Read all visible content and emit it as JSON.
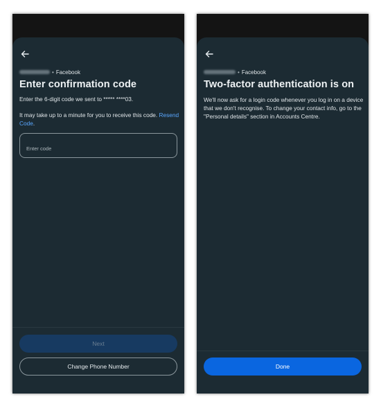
{
  "left_screen": {
    "account": {
      "name": "",
      "separator": "•",
      "app": "Facebook"
    },
    "title": "Enter confirmation code",
    "instruction": "Enter the 6-digit code we sent to ***** ****03.",
    "wait_text": "It may take up to a minute for you to receive this code.",
    "resend_link": "Resend Code",
    "resend_suffix": ".",
    "code_input": {
      "value": "",
      "placeholder": "Enter code"
    },
    "next_button": "Next",
    "change_phone_button": "Change Phone Number"
  },
  "right_screen": {
    "account": {
      "name": "",
      "separator": "•",
      "app": "Facebook"
    },
    "title": "Two-factor authentication is on",
    "body": "We'll now ask for a login code whenever you log in on a device that we don't recognise. To change your contact info, go to the \"Personal details\" section in Accounts Centre.",
    "done_button": "Done"
  },
  "colors": {
    "sheet_background": "#1c2b33",
    "phone_frame": "#141414",
    "link": "#5aa7ff",
    "primary_button": "#0a66e0",
    "disabled_button": "#173a61"
  },
  "icons": {
    "back": "arrow-left-icon"
  }
}
